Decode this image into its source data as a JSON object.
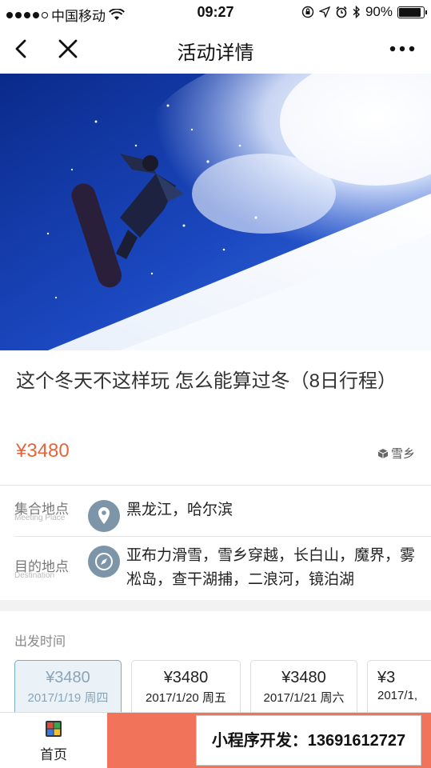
{
  "status_bar": {
    "carrier": "中国移动",
    "time": "09:27",
    "battery": "90%",
    "battery_level": 0.9
  },
  "nav": {
    "title": "活动详情",
    "back_icon": "chevron-left-icon",
    "close_icon": "close-icon",
    "more_icon": "more-icon"
  },
  "activity": {
    "title": "这个冬天不这样玩 怎么能算过冬（8日行程）",
    "price": "¥3480",
    "tag": "雪乡"
  },
  "meeting_place": {
    "label": "集合地点",
    "sub_label": "Meeting Place",
    "value": "黑龙江，哈尔滨",
    "icon": "location-pin-icon"
  },
  "destination": {
    "label": "目的地点",
    "sub_label": "Destination",
    "value": "亚布力滑雪，雪乡穿越，长白山，魔界，雾凇岛，查干湖捕，二浪河，镜泊湖",
    "icon": "compass-icon"
  },
  "departure": {
    "label": "出发时间",
    "dates": [
      {
        "price": "¥3480",
        "date": "2017/1/19 周四",
        "selected": true
      },
      {
        "price": "¥3480",
        "date": "2017/1/20 周五",
        "selected": false
      },
      {
        "price": "¥3480",
        "date": "2017/1/21 周六",
        "selected": false
      },
      {
        "price": "¥3",
        "date": "2017/1,",
        "selected": false
      }
    ]
  },
  "tab_bar": {
    "home_label": "首页",
    "home_icon": "home-grid-icon",
    "cta_color": "#f0735a"
  },
  "watermark": "小程序开发：13691612727",
  "colors": {
    "price": "#e8643a",
    "icon_circle": "#7d95a8",
    "selected_card_bg": "#eaf2f8"
  }
}
